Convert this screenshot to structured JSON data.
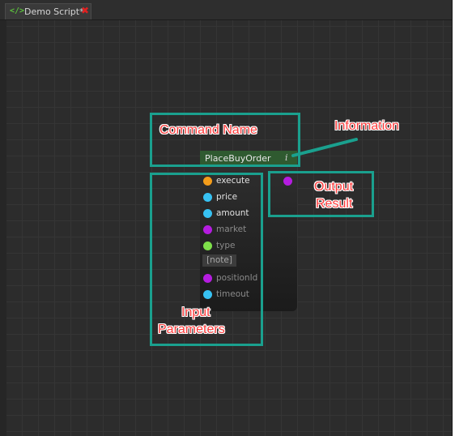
{
  "tab": {
    "icon": "code-icon",
    "label": "Demo Script*",
    "close_icon": "close-icon"
  },
  "node": {
    "title": "PlaceBuyOrder",
    "info_icon": "info-icon",
    "info_glyph": "i",
    "inputs": [
      {
        "label": "execute",
        "color": "#f39c1a",
        "label_color": "#e2e2e2"
      },
      {
        "label": "price",
        "color": "#37c1f2",
        "label_color": "#e2e2e2"
      },
      {
        "label": "amount",
        "color": "#37c1f2",
        "label_color": "#e2e2e2"
      },
      {
        "label": "market",
        "color": "#b51ce0",
        "label_color": "#8a8a8a"
      },
      {
        "label": "type",
        "color": "#7ee04a",
        "label_color": "#8a8a8a"
      },
      {
        "label": "positionId",
        "color": "#b51ce0",
        "label_color": "#8a8a8a"
      },
      {
        "label": "timeout",
        "color": "#37c1f2",
        "label_color": "#8a8a8a"
      }
    ],
    "note": "[note]",
    "output_color": "#b51ce0"
  },
  "annotations": {
    "command_name": "Command Name",
    "information": "Information",
    "output_line1": "Output",
    "output_line2": "Result",
    "input_line1": "Input",
    "input_line2": "Parameters",
    "box_color": "#1aa08e",
    "text_color": "#ff3b3b"
  }
}
